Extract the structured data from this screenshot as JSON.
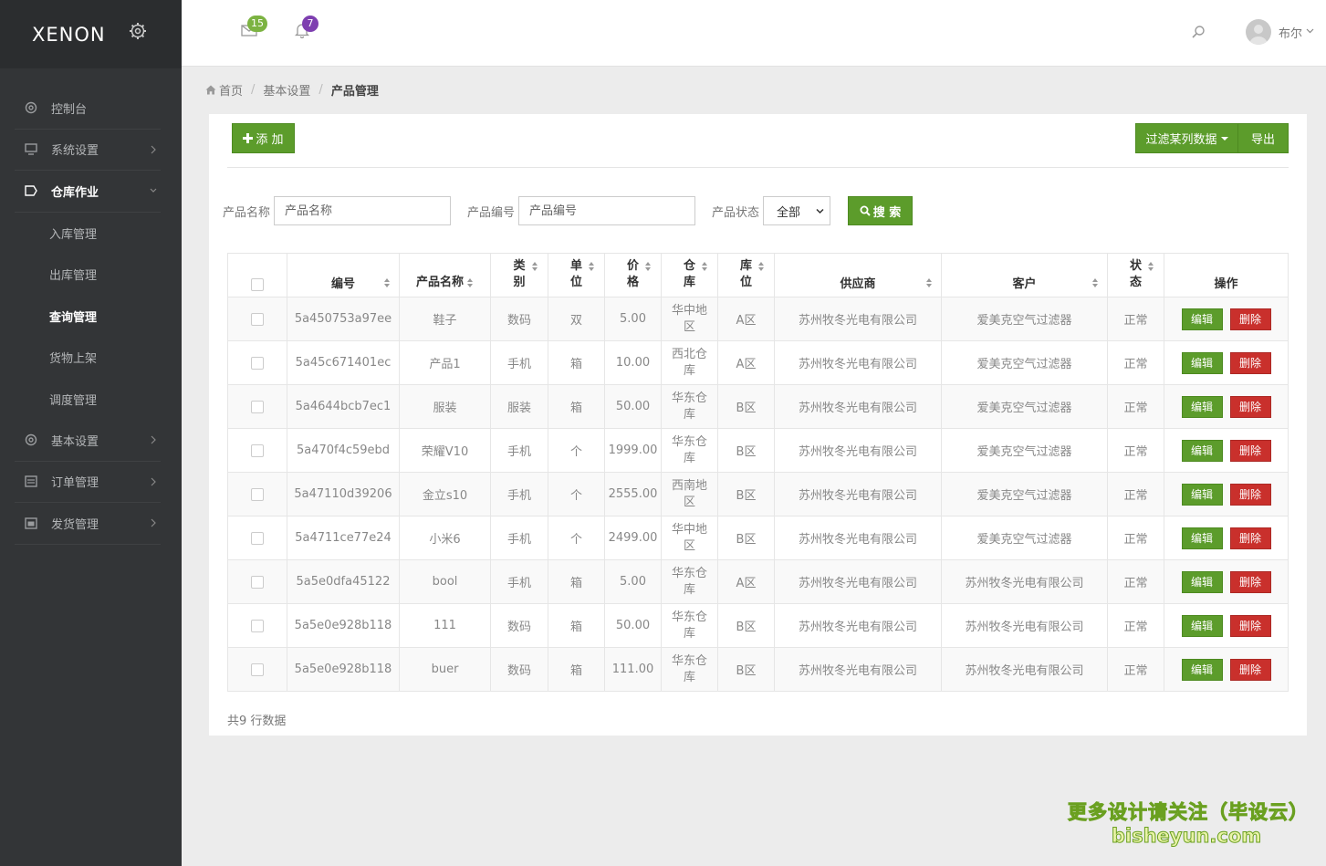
{
  "brand": {
    "name": "XENON"
  },
  "sidebar": {
    "items": [
      {
        "label": "控制台",
        "icon": "dashboard-icon"
      },
      {
        "label": "系统设置",
        "icon": "monitor-icon"
      },
      {
        "label": "仓库作业",
        "icon": "tag-icon"
      },
      {
        "label": "基本设置",
        "icon": "gear-icon"
      },
      {
        "label": "订单管理",
        "icon": "document-icon"
      },
      {
        "label": "发货管理",
        "icon": "calendar-icon"
      }
    ],
    "subitems": [
      "入库管理",
      "出库管理",
      "查询管理",
      "货物上架",
      "调度管理"
    ]
  },
  "topbar": {
    "mail_count": "15",
    "notify_count": "7",
    "username": "布尔"
  },
  "breadcrumb": {
    "home": "首页",
    "level1": "基本设置",
    "current": "产品管理"
  },
  "toolbar": {
    "add_label": "添 加",
    "filter_label": "过滤某列数据",
    "export_label": "导出"
  },
  "search": {
    "name_label": "产品名称",
    "name_placeholder": "产品名称",
    "code_label": "产品编号",
    "code_placeholder": "产品编号",
    "status_label": "产品状态",
    "status_value": "全部",
    "search_label": "搜 索"
  },
  "table": {
    "headers": {
      "code": "编号",
      "name": "产品名称",
      "category_1": "类",
      "category_2": "别",
      "unit_1": "单",
      "unit_2": "位",
      "price_1": "价",
      "price_2": "格",
      "warehouse_1": "仓",
      "warehouse_2": "库",
      "location_1": "库",
      "location_2": "位",
      "supplier": "供应商",
      "customer": "客户",
      "status_1": "状",
      "status_2": "态",
      "actions": "操作"
    },
    "edit_label": "编辑",
    "delete_label": "删除",
    "rows": [
      {
        "code": "5a450753a97ee",
        "name": "鞋子",
        "category": "数码",
        "unit": "双",
        "price": "5.00",
        "wh1": "华中地",
        "wh2": "区",
        "location": "A区",
        "supplier": "苏州牧冬光电有限公司",
        "customer": "爱美克空气过滤器",
        "status": "正常"
      },
      {
        "code": "5a45c671401ec",
        "name": "产品1",
        "category": "手机",
        "unit": "箱",
        "price": "10.00",
        "wh1": "西北仓",
        "wh2": "库",
        "location": "A区",
        "supplier": "苏州牧冬光电有限公司",
        "customer": "爱美克空气过滤器",
        "status": "正常"
      },
      {
        "code": "5a4644bcb7ec1",
        "name": "服装",
        "category": "服装",
        "unit": "箱",
        "price": "50.00",
        "wh1": "华东仓",
        "wh2": "库",
        "location": "B区",
        "supplier": "苏州牧冬光电有限公司",
        "customer": "爱美克空气过滤器",
        "status": "正常"
      },
      {
        "code": "5a470f4c59ebd",
        "name": "荣耀V10",
        "category": "手机",
        "unit": "个",
        "price": "1999.00",
        "wh1": "华东仓",
        "wh2": "库",
        "location": "B区",
        "supplier": "苏州牧冬光电有限公司",
        "customer": "爱美克空气过滤器",
        "status": "正常"
      },
      {
        "code": "5a47110d39206",
        "name": "金立s10",
        "category": "手机",
        "unit": "个",
        "price": "2555.00",
        "wh1": "西南地",
        "wh2": "区",
        "location": "B区",
        "supplier": "苏州牧冬光电有限公司",
        "customer": "爱美克空气过滤器",
        "status": "正常"
      },
      {
        "code": "5a4711ce77e24",
        "name": "小米6",
        "category": "手机",
        "unit": "个",
        "price": "2499.00",
        "wh1": "华中地",
        "wh2": "区",
        "location": "B区",
        "supplier": "苏州牧冬光电有限公司",
        "customer": "爱美克空气过滤器",
        "status": "正常"
      },
      {
        "code": "5a5e0dfa45122",
        "name": "bool",
        "category": "手机",
        "unit": "箱",
        "price": "5.00",
        "wh1": "华东仓",
        "wh2": "库",
        "location": "A区",
        "supplier": "苏州牧冬光电有限公司",
        "customer": "苏州牧冬光电有限公司",
        "status": "正常"
      },
      {
        "code": "5a5e0e928b118",
        "name": "111",
        "category": "数码",
        "unit": "箱",
        "price": "50.00",
        "wh1": "华东仓",
        "wh2": "库",
        "location": "B区",
        "supplier": "苏州牧冬光电有限公司",
        "customer": "苏州牧冬光电有限公司",
        "status": "正常"
      },
      {
        "code": "5a5e0e928b118",
        "name": "buer",
        "category": "数码",
        "unit": "箱",
        "price": "111.00",
        "wh1": "华东仓",
        "wh2": "库",
        "location": "B区",
        "supplier": "苏州牧冬光电有限公司",
        "customer": "苏州牧冬光电有限公司",
        "status": "正常"
      }
    ]
  },
  "footer": {
    "count_text": "共9 行数据"
  },
  "watermark": {
    "line1": "更多设计请关注（毕设云）",
    "line2": "bisheyun.com"
  },
  "colors": {
    "sidebar": "#333537",
    "accent_green": "#5c9c2b",
    "danger_red": "#c9302c",
    "badge_purple": "#7e3fb0"
  }
}
